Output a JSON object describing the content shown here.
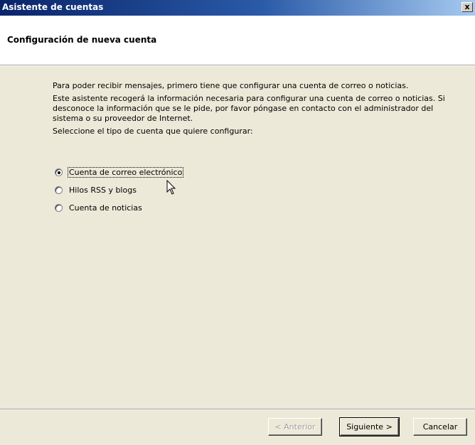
{
  "window": {
    "title": "Asistente de cuentas",
    "close_glyph": "x"
  },
  "header": {
    "title": "Configuración de nueva cuenta"
  },
  "content": {
    "paragraph1": "Para poder recibir mensajes, primero tiene que configurar una cuenta de correo o noticias.",
    "paragraph2": "Este asistente recogerá la información necesaria para configurar una cuenta de correo o noticias. Si desconoce la información que se le pide, por favor póngase en contacto con el administrador del sistema o su proveedor de Internet.",
    "paragraph3": "Seleccione el tipo de cuenta que quiere configurar:"
  },
  "account_types": [
    {
      "label": "Cuenta de correo electrónico",
      "selected": true
    },
    {
      "label": "Hilos RSS y blogs",
      "selected": false
    },
    {
      "label": "Cuenta de noticias",
      "selected": false
    }
  ],
  "buttons": {
    "back": "< Anterior",
    "next": "Siguiente >",
    "cancel": "Cancelar"
  },
  "colors": {
    "titlebar_start": "#0a246a",
    "titlebar_end": "#a6caf0",
    "dialog_bg": "#ece9d8"
  }
}
